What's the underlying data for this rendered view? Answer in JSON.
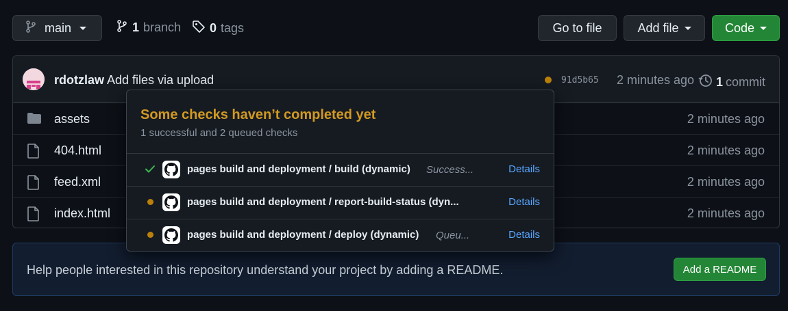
{
  "toolbar": {
    "branch_label": "main",
    "branch_count": "1",
    "branch_word": "branch",
    "tag_count": "0",
    "tag_word": "tags",
    "go_to_file": "Go to file",
    "add_file": "Add file",
    "code": "Code"
  },
  "commit": {
    "author": "rdotzlaw",
    "message": "Add files via upload",
    "sha": "91d5b65",
    "time": "2 minutes ago",
    "commit_count": "1",
    "commit_word": "commit",
    "status_color": "#bb8009"
  },
  "files": [
    {
      "name": "assets",
      "type": "folder",
      "time": "2 minutes ago"
    },
    {
      "name": "404.html",
      "type": "file",
      "time": "2 minutes ago"
    },
    {
      "name": "feed.xml",
      "type": "file",
      "time": "2 minutes ago"
    },
    {
      "name": "index.html",
      "type": "file",
      "time": "2 minutes ago"
    }
  ],
  "checks_popover": {
    "title": "Some checks haven’t completed yet",
    "subtitle": "1 successful and 2 queued checks",
    "checks": [
      {
        "status": "success",
        "status_icon": "check-icon",
        "name": "pages build and deployment / build (dynamic)",
        "description": "Success...",
        "details": "Details"
      },
      {
        "status": "queued",
        "status_icon": "queued-dot-icon",
        "name": "pages build and deployment / report-build-status (dyn...",
        "description": "",
        "details": "Details"
      },
      {
        "status": "queued",
        "status_icon": "queued-dot-icon",
        "name": "pages build and deployment / deploy (dynamic)",
        "description": "Queu...",
        "details": "Details"
      }
    ]
  },
  "readme_banner": {
    "text": "Help people interested in this repository understand your project by adding a README.",
    "button": "Add a README"
  },
  "colors": {
    "accent_green": "#238636",
    "warning": "#d29922",
    "link": "#58a6ff",
    "background": "#0d1117"
  }
}
